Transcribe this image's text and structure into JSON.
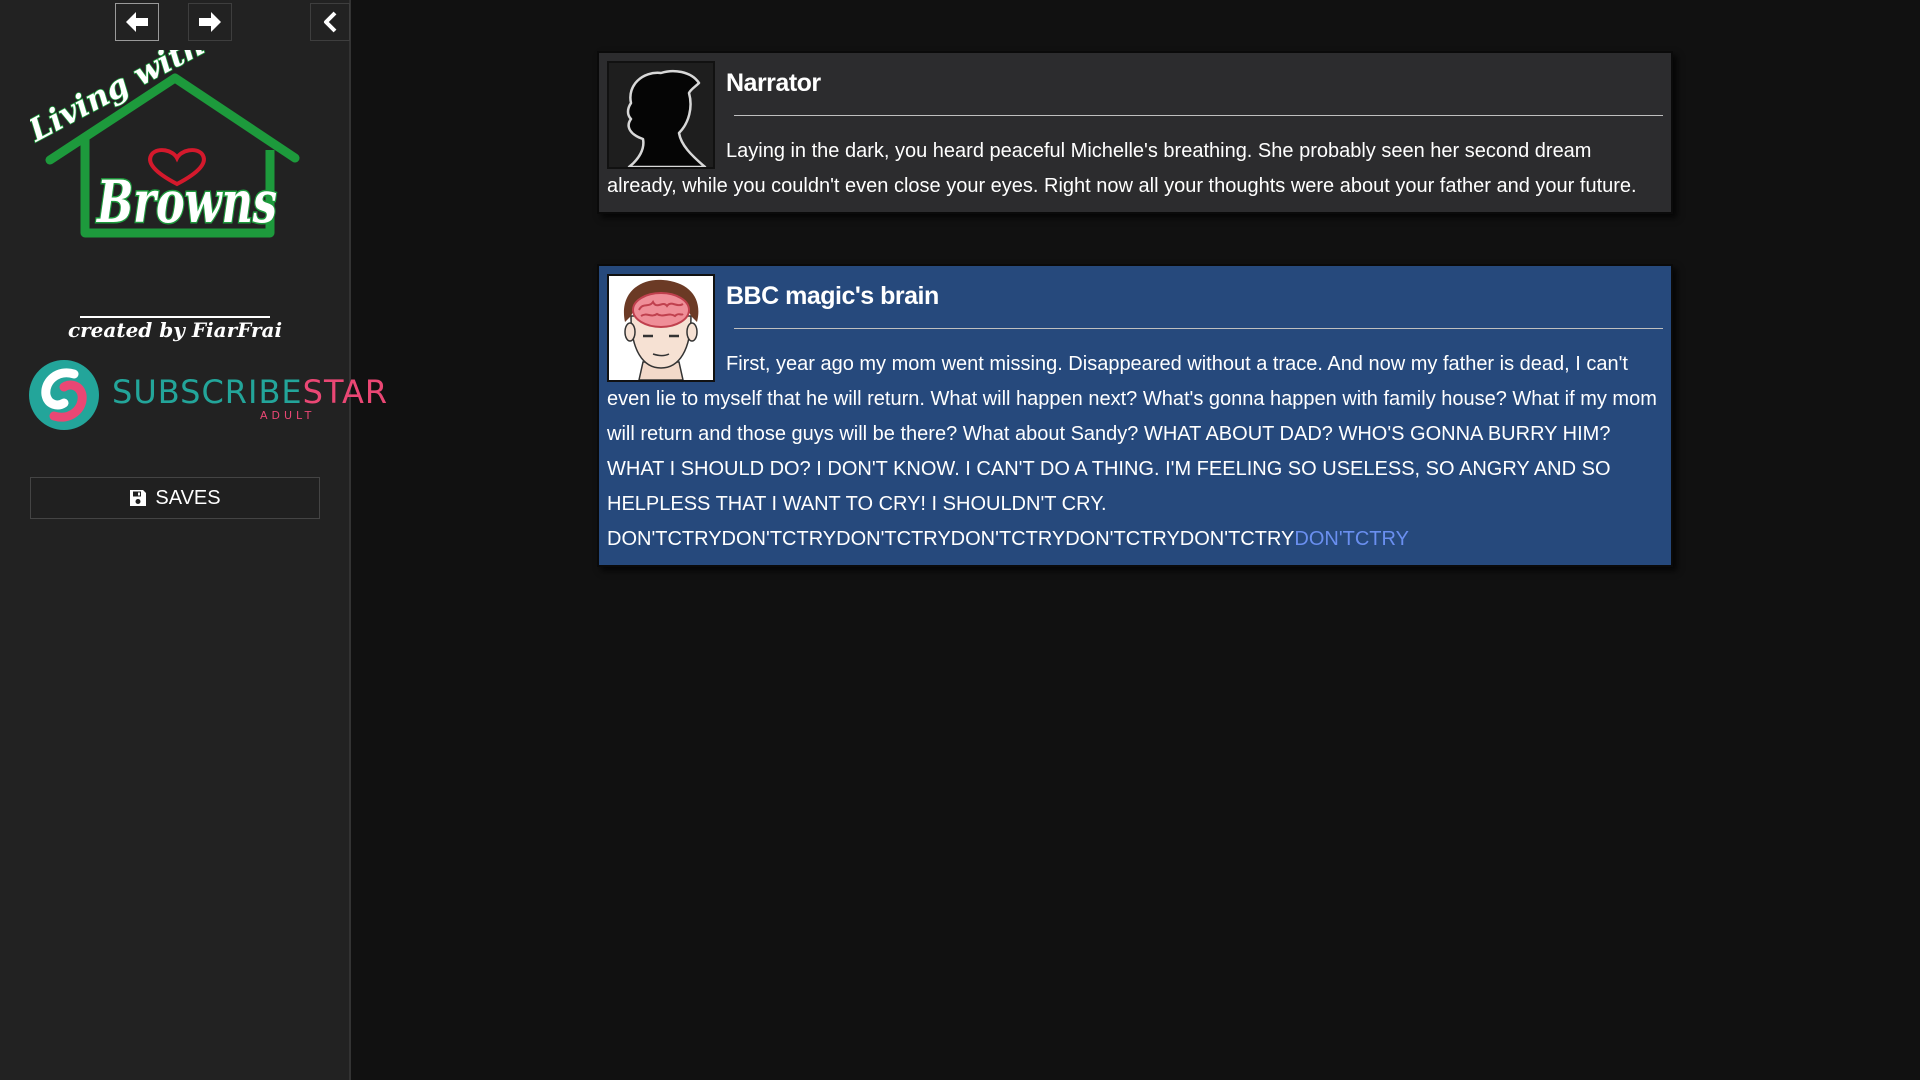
{
  "toolbar": {
    "back_icon": "arrow-left-icon",
    "forward_icon": "arrow-right-icon",
    "collapse_icon": "chevron-left-icon"
  },
  "sidebar": {
    "logo": {
      "line1": "Living with",
      "line2": "Browns",
      "colors": {
        "house": "#1d9a3c",
        "heart": "#d4192c",
        "text": "#ffffff"
      }
    },
    "creator": "created by FiarFrai",
    "subscribestar": {
      "part1": "SUBSCRIBE",
      "part2": "STAR",
      "sub": "ADULT",
      "colors": {
        "teal": "#23a59a",
        "pink": "#ea4774"
      }
    },
    "saves": {
      "label": "SAVES",
      "icon": "floppy-disk-icon"
    }
  },
  "story": [
    {
      "speaker": "Narrator",
      "avatar": "silhouette-avatar",
      "text": "Laying in the dark, you heard peaceful Michelle's breathing. She probably seen her second dream already, while you couldn't even close your eyes. Right now all your thoughts were about your father and your future."
    },
    {
      "speaker": "BBC magic's brain",
      "avatar": "brain-avatar",
      "text": "First, year ago my mom went missing. Disappeared without a trace. And now my father is dead, I can't even lie to myself that he will return. What will happen next? What's gonna happen with family house? What if my mom will return and those guys will be there? What about Sandy? WHAT ABOUT DAD? WHO'S GONNA BURRY HIM? WHAT I SHOULD DO? I DON'T KNOW. I CAN'T DO A THING. I'M FEELING SO USELESS, SO ANGRY AND SO HELPLESS THAT I WANT TO CRY! I SHOULDN'T CRY. DON'TCTRYDON'TCTRYDON'TCTRYDON'TCTRYDON'TCTRYDON'TCTRY",
      "link": "DON'TCTRY"
    }
  ],
  "colors": {
    "background": "#111111",
    "sidebar": "#222222",
    "narrator_panel": "#2c2c2e",
    "character_panel": "#26497c",
    "link": "#6a8ff0"
  }
}
